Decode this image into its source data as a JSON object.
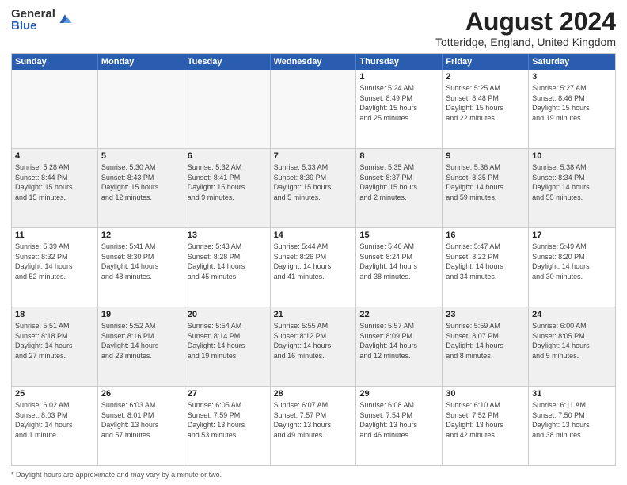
{
  "logo": {
    "general": "General",
    "blue": "Blue"
  },
  "title": "August 2024",
  "subtitle": "Totteridge, England, United Kingdom",
  "weekdays": [
    "Sunday",
    "Monday",
    "Tuesday",
    "Wednesday",
    "Thursday",
    "Friday",
    "Saturday"
  ],
  "note": "Daylight hours",
  "weeks": [
    [
      {
        "day": "",
        "info": ""
      },
      {
        "day": "",
        "info": ""
      },
      {
        "day": "",
        "info": ""
      },
      {
        "day": "",
        "info": ""
      },
      {
        "day": "1",
        "info": "Sunrise: 5:24 AM\nSunset: 8:49 PM\nDaylight: 15 hours\nand 25 minutes."
      },
      {
        "day": "2",
        "info": "Sunrise: 5:25 AM\nSunset: 8:48 PM\nDaylight: 15 hours\nand 22 minutes."
      },
      {
        "day": "3",
        "info": "Sunrise: 5:27 AM\nSunset: 8:46 PM\nDaylight: 15 hours\nand 19 minutes."
      }
    ],
    [
      {
        "day": "4",
        "info": "Sunrise: 5:28 AM\nSunset: 8:44 PM\nDaylight: 15 hours\nand 15 minutes."
      },
      {
        "day": "5",
        "info": "Sunrise: 5:30 AM\nSunset: 8:43 PM\nDaylight: 15 hours\nand 12 minutes."
      },
      {
        "day": "6",
        "info": "Sunrise: 5:32 AM\nSunset: 8:41 PM\nDaylight: 15 hours\nand 9 minutes."
      },
      {
        "day": "7",
        "info": "Sunrise: 5:33 AM\nSunset: 8:39 PM\nDaylight: 15 hours\nand 5 minutes."
      },
      {
        "day": "8",
        "info": "Sunrise: 5:35 AM\nSunset: 8:37 PM\nDaylight: 15 hours\nand 2 minutes."
      },
      {
        "day": "9",
        "info": "Sunrise: 5:36 AM\nSunset: 8:35 PM\nDaylight: 14 hours\nand 59 minutes."
      },
      {
        "day": "10",
        "info": "Sunrise: 5:38 AM\nSunset: 8:34 PM\nDaylight: 14 hours\nand 55 minutes."
      }
    ],
    [
      {
        "day": "11",
        "info": "Sunrise: 5:39 AM\nSunset: 8:32 PM\nDaylight: 14 hours\nand 52 minutes."
      },
      {
        "day": "12",
        "info": "Sunrise: 5:41 AM\nSunset: 8:30 PM\nDaylight: 14 hours\nand 48 minutes."
      },
      {
        "day": "13",
        "info": "Sunrise: 5:43 AM\nSunset: 8:28 PM\nDaylight: 14 hours\nand 45 minutes."
      },
      {
        "day": "14",
        "info": "Sunrise: 5:44 AM\nSunset: 8:26 PM\nDaylight: 14 hours\nand 41 minutes."
      },
      {
        "day": "15",
        "info": "Sunrise: 5:46 AM\nSunset: 8:24 PM\nDaylight: 14 hours\nand 38 minutes."
      },
      {
        "day": "16",
        "info": "Sunrise: 5:47 AM\nSunset: 8:22 PM\nDaylight: 14 hours\nand 34 minutes."
      },
      {
        "day": "17",
        "info": "Sunrise: 5:49 AM\nSunset: 8:20 PM\nDaylight: 14 hours\nand 30 minutes."
      }
    ],
    [
      {
        "day": "18",
        "info": "Sunrise: 5:51 AM\nSunset: 8:18 PM\nDaylight: 14 hours\nand 27 minutes."
      },
      {
        "day": "19",
        "info": "Sunrise: 5:52 AM\nSunset: 8:16 PM\nDaylight: 14 hours\nand 23 minutes."
      },
      {
        "day": "20",
        "info": "Sunrise: 5:54 AM\nSunset: 8:14 PM\nDaylight: 14 hours\nand 19 minutes."
      },
      {
        "day": "21",
        "info": "Sunrise: 5:55 AM\nSunset: 8:12 PM\nDaylight: 14 hours\nand 16 minutes."
      },
      {
        "day": "22",
        "info": "Sunrise: 5:57 AM\nSunset: 8:09 PM\nDaylight: 14 hours\nand 12 minutes."
      },
      {
        "day": "23",
        "info": "Sunrise: 5:59 AM\nSunset: 8:07 PM\nDaylight: 14 hours\nand 8 minutes."
      },
      {
        "day": "24",
        "info": "Sunrise: 6:00 AM\nSunset: 8:05 PM\nDaylight: 14 hours\nand 5 minutes."
      }
    ],
    [
      {
        "day": "25",
        "info": "Sunrise: 6:02 AM\nSunset: 8:03 PM\nDaylight: 14 hours\nand 1 minute."
      },
      {
        "day": "26",
        "info": "Sunrise: 6:03 AM\nSunset: 8:01 PM\nDaylight: 13 hours\nand 57 minutes."
      },
      {
        "day": "27",
        "info": "Sunrise: 6:05 AM\nSunset: 7:59 PM\nDaylight: 13 hours\nand 53 minutes."
      },
      {
        "day": "28",
        "info": "Sunrise: 6:07 AM\nSunset: 7:57 PM\nDaylight: 13 hours\nand 49 minutes."
      },
      {
        "day": "29",
        "info": "Sunrise: 6:08 AM\nSunset: 7:54 PM\nDaylight: 13 hours\nand 46 minutes."
      },
      {
        "day": "30",
        "info": "Sunrise: 6:10 AM\nSunset: 7:52 PM\nDaylight: 13 hours\nand 42 minutes."
      },
      {
        "day": "31",
        "info": "Sunrise: 6:11 AM\nSunset: 7:50 PM\nDaylight: 13 hours\nand 38 minutes."
      }
    ]
  ]
}
